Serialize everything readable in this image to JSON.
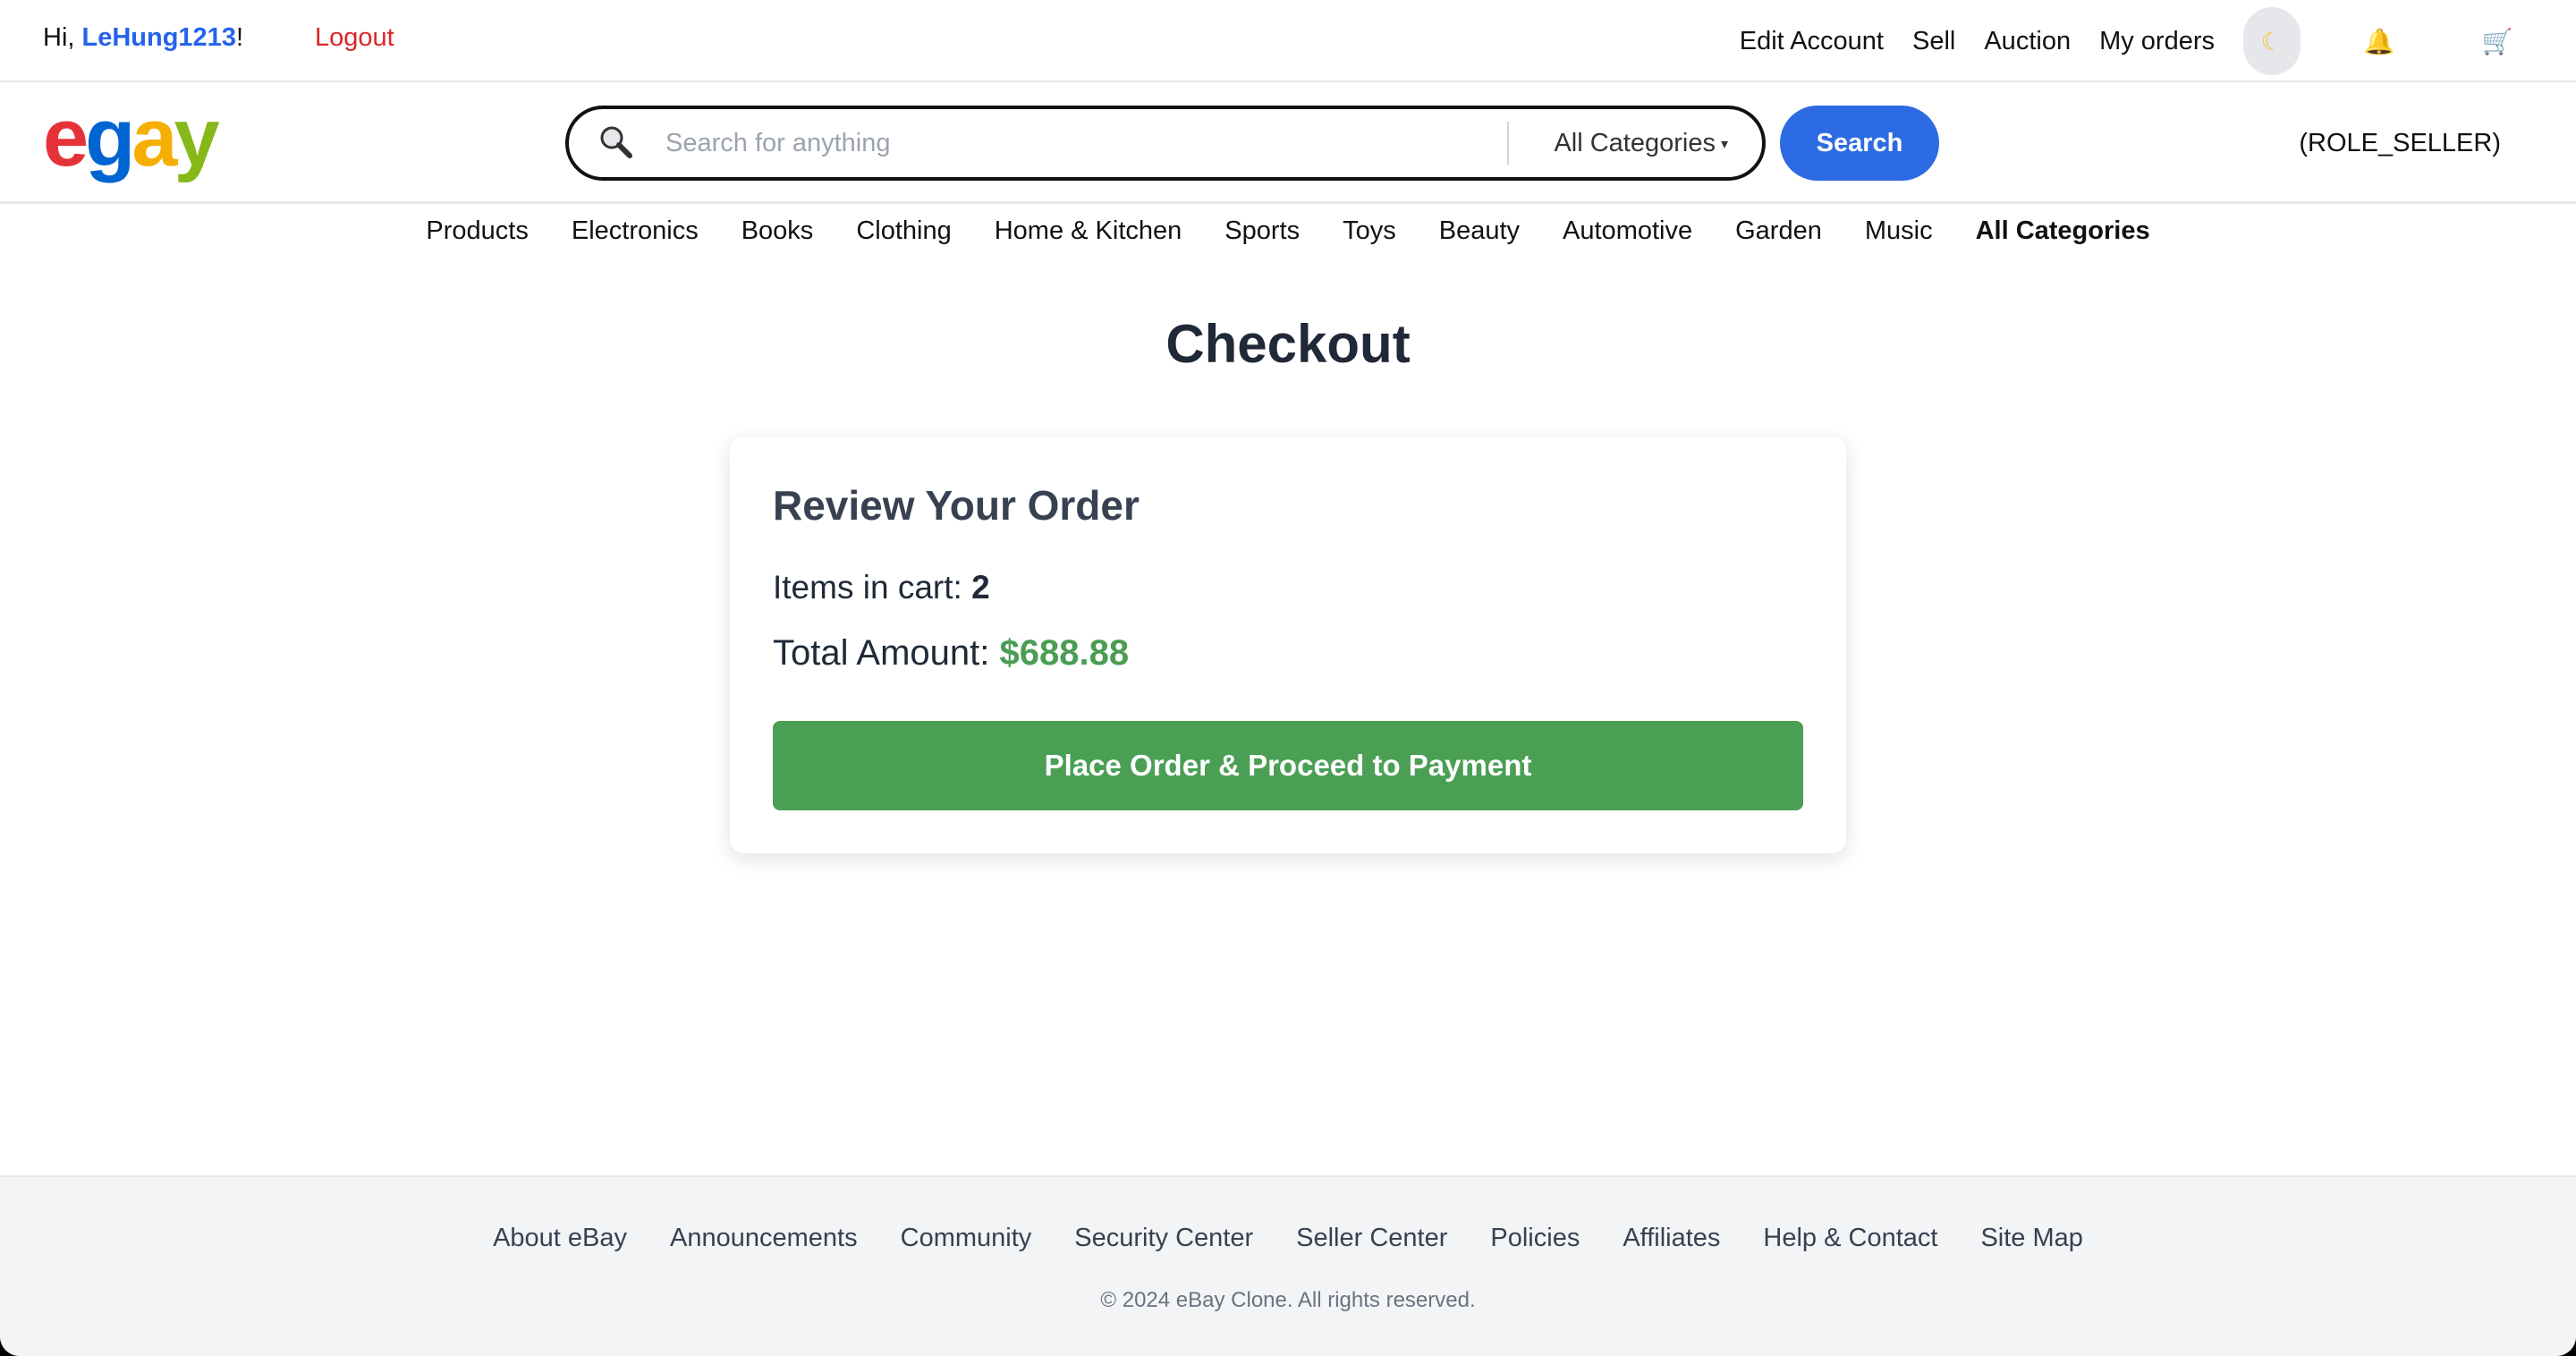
{
  "topbar": {
    "greeting_prefix": "Hi, ",
    "username": "LeHung1213",
    "greeting_suffix": "!",
    "logout_label": "Logout",
    "links": [
      "Edit Account",
      "Sell",
      "Auction",
      "My orders"
    ],
    "theme_icon": "moon-icon",
    "notification_icon": "bell-icon",
    "cart_icon": "cart-icon"
  },
  "header": {
    "logo_letters": [
      "e",
      "g",
      "a",
      "y"
    ],
    "search_placeholder": "Search for anything",
    "category_selected": "All Categories",
    "search_button": "Search",
    "role": "(ROLE_SELLER)"
  },
  "nav": {
    "categories": [
      "Products",
      "Electronics",
      "Books",
      "Clothing",
      "Home & Kitchen",
      "Sports",
      "Toys",
      "Beauty",
      "Automotive",
      "Garden",
      "Music",
      "All Categories"
    ]
  },
  "main": {
    "title": "Checkout",
    "card": {
      "heading": "Review Your Order",
      "items_label": "Items in cart: ",
      "items_count": "2",
      "total_label": "Total Amount: ",
      "total_value": "$688.88",
      "button_label": "Place Order & Proceed to Payment"
    }
  },
  "footer": {
    "links": [
      "About eBay",
      "Announcements",
      "Community",
      "Security Center",
      "Seller Center",
      "Policies",
      "Affiliates",
      "Help & Contact",
      "Site Map"
    ],
    "copyright": "© 2024 eBay Clone. All rights reserved."
  },
  "colors": {
    "accent_blue": "#2d6be4",
    "success_green": "#4a9f55",
    "logout_red": "#dc2626"
  }
}
